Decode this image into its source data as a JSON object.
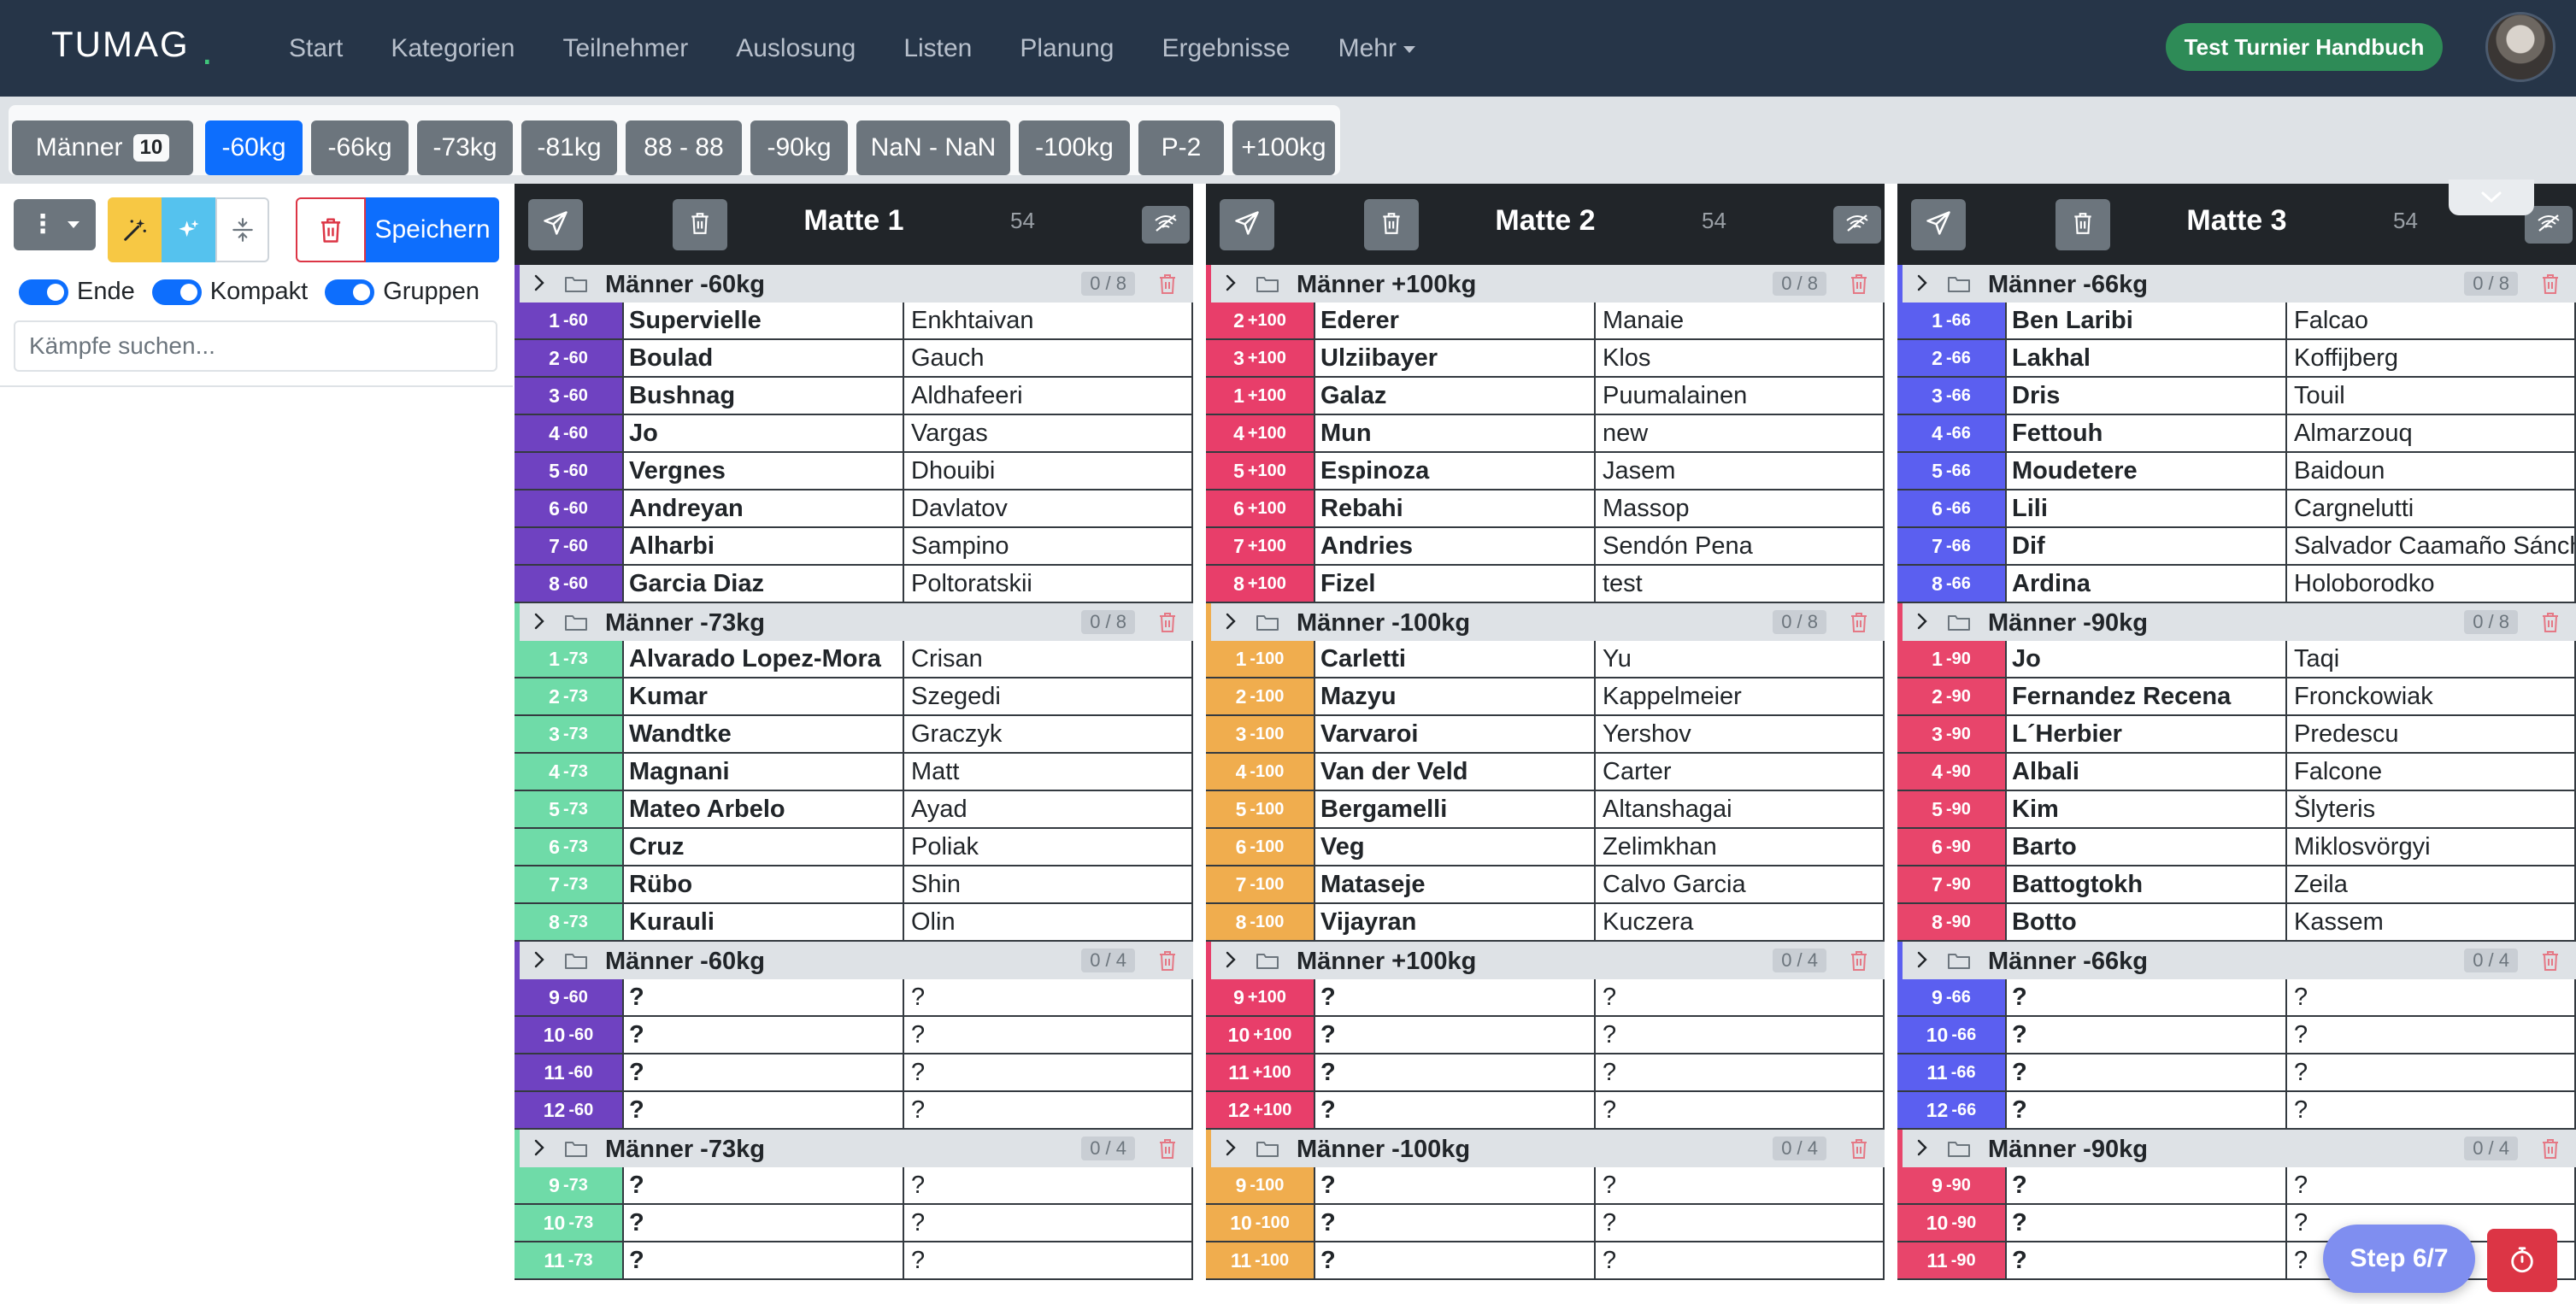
{
  "navbar": {
    "brand": "TUMAG",
    "links": [
      "Start",
      "Kategorien",
      "Teilnehmer",
      "Auslosung",
      "Listen",
      "Planung",
      "Ergebnisse",
      "Mehr"
    ],
    "tournament_button": "Test Turnier Handbuch"
  },
  "categories": {
    "group_label": "Männer",
    "group_count": "10",
    "items": [
      "-60kg",
      "-66kg",
      "-73kg",
      "-81kg",
      "88 - 88",
      "-90kg",
      "NaN - NaN",
      "-100kg",
      "P-2",
      "+100kg"
    ],
    "active": "-60kg"
  },
  "toolbar": {
    "save_label": "Speichern",
    "toggles": [
      "Ende",
      "Kompakt",
      "Gruppen"
    ],
    "search_placeholder": "Kämpfe suchen..."
  },
  "mats": [
    {
      "title": "Matte 1",
      "count": "54",
      "groups": [
        {
          "title": "Männer -60kg",
          "count": "0 / 8",
          "color": "#6f42c1",
          "weight": "-60",
          "rows": [
            [
              "1",
              "Supervielle",
              "Enkhtaivan"
            ],
            [
              "2",
              "Boulad",
              "Gauch"
            ],
            [
              "3",
              "Bushnag",
              "Aldhafeeri"
            ],
            [
              "4",
              "Jo",
              "Vargas"
            ],
            [
              "5",
              "Vergnes",
              "Dhouibi"
            ],
            [
              "6",
              "Andreyan",
              "Davlatov"
            ],
            [
              "7",
              "Alharbi",
              "Sampino"
            ],
            [
              "8",
              "Garcia Diaz",
              "Poltoratskii"
            ]
          ]
        },
        {
          "title": "Männer -73kg",
          "count": "0 / 8",
          "color": "#6fdba8",
          "weight": "-73",
          "rows": [
            [
              "1",
              "Alvarado Lopez-Mora",
              "Crisan"
            ],
            [
              "2",
              "Kumar",
              "Szegedi"
            ],
            [
              "3",
              "Wandtke",
              "Graczyk"
            ],
            [
              "4",
              "Magnani",
              "Matt"
            ],
            [
              "5",
              "Mateo Arbelo",
              "Ayad"
            ],
            [
              "6",
              "Cruz",
              "Poliak"
            ],
            [
              "7",
              "Rübo",
              "Shin"
            ],
            [
              "8",
              "Kurauli",
              "Olin"
            ]
          ]
        },
        {
          "title": "Männer -60kg",
          "count": "0 / 4",
          "color": "#6f42c1",
          "weight": "-60",
          "rows": [
            [
              "9",
              "?",
              "?"
            ],
            [
              "10",
              "?",
              "?"
            ],
            [
              "11",
              "?",
              "?"
            ],
            [
              "12",
              "?",
              "?"
            ]
          ]
        },
        {
          "title": "Männer -73kg",
          "count": "0 / 4",
          "color": "#6fdba8",
          "weight": "-73",
          "rows": [
            [
              "9",
              "?",
              "?"
            ],
            [
              "10",
              "?",
              "?"
            ],
            [
              "11",
              "?",
              "?"
            ]
          ]
        }
      ]
    },
    {
      "title": "Matte 2",
      "count": "54",
      "groups": [
        {
          "title": "Männer +100kg",
          "count": "0 / 8",
          "color": "#e83e6a",
          "weight": "+100",
          "rows": [
            [
              "2",
              "Ederer",
              "Manaie"
            ],
            [
              "3",
              "Ulziibayer",
              "Klos"
            ],
            [
              "1",
              "Galaz",
              "Puumalainen"
            ],
            [
              "4",
              "Mun",
              "new"
            ],
            [
              "5",
              "Espinoza",
              "Jasem"
            ],
            [
              "6",
              "Rebahi",
              "Massop"
            ],
            [
              "7",
              "Andries",
              "Sendón Pena"
            ],
            [
              "8",
              "Fizel",
              "test"
            ]
          ]
        },
        {
          "title": "Männer -100kg",
          "count": "0 / 8",
          "color": "#f0ad4e",
          "weight": "-100",
          "rows": [
            [
              "1",
              "Carletti",
              "Yu"
            ],
            [
              "2",
              "Mazyu",
              "Kappelmeier"
            ],
            [
              "3",
              "Varvaroi",
              "Yershov"
            ],
            [
              "4",
              "Van der Veld",
              "Carter"
            ],
            [
              "5",
              "Bergamelli",
              "Altanshagai"
            ],
            [
              "6",
              "Veg",
              "Zelimkhan"
            ],
            [
              "7",
              "Mataseje",
              "Calvo Garcia"
            ],
            [
              "8",
              "Vijayran",
              "Kuczera"
            ]
          ]
        },
        {
          "title": "Männer +100kg",
          "count": "0 / 4",
          "color": "#e83e6a",
          "weight": "+100",
          "rows": [
            [
              "9",
              "?",
              "?"
            ],
            [
              "10",
              "?",
              "?"
            ],
            [
              "11",
              "?",
              "?"
            ],
            [
              "12",
              "?",
              "?"
            ]
          ]
        },
        {
          "title": "Männer -100kg",
          "count": "0 / 4",
          "color": "#f0ad4e",
          "weight": "-100",
          "rows": [
            [
              "9",
              "?",
              "?"
            ],
            [
              "10",
              "?",
              "?"
            ],
            [
              "11",
              "?",
              "?"
            ]
          ]
        }
      ]
    },
    {
      "title": "Matte 3",
      "count": "54",
      "groups": [
        {
          "title": "Männer -66kg",
          "count": "0 / 8",
          "color": "#5b5ff0",
          "weight": "-66",
          "rows": [
            [
              "1",
              "Ben Laribi",
              "Falcao"
            ],
            [
              "2",
              "Lakhal",
              "Koffijberg"
            ],
            [
              "3",
              "Dris",
              "Touil"
            ],
            [
              "4",
              "Fettouh",
              "Almarzouq"
            ],
            [
              "5",
              "Moudetere",
              "Baidoun"
            ],
            [
              "6",
              "Lili",
              "Cargnelutti"
            ],
            [
              "7",
              "Dif",
              "Salvador Caamaño Sánchez"
            ],
            [
              "8",
              "Ardina",
              "Holoborodko"
            ]
          ]
        },
        {
          "title": "Männer -90kg",
          "count": "0 / 8",
          "color": "#e8456b",
          "weight": "-90",
          "rows": [
            [
              "1",
              "Jo",
              "Taqi"
            ],
            [
              "2",
              "Fernandez Recena",
              "Fronckowiak"
            ],
            [
              "3",
              "L´Herbier",
              "Predescu"
            ],
            [
              "4",
              "Albali",
              "Falcone"
            ],
            [
              "5",
              "Kim",
              "Šlyteris"
            ],
            [
              "6",
              "Barto",
              "Miklosvörgyi"
            ],
            [
              "7",
              "Battogtokh",
              "Zeila"
            ],
            [
              "8",
              "Botto",
              "Kassem"
            ]
          ]
        },
        {
          "title": "Männer -66kg",
          "count": "0 / 4",
          "color": "#5b5ff0",
          "weight": "-66",
          "rows": [
            [
              "9",
              "?",
              "?"
            ],
            [
              "10",
              "?",
              "?"
            ],
            [
              "11",
              "?",
              "?"
            ],
            [
              "12",
              "?",
              "?"
            ]
          ]
        },
        {
          "title": "Männer -90kg",
          "count": "0 / 4",
          "color": "#e8456b",
          "weight": "-90",
          "rows": [
            [
              "9",
              "?",
              "?"
            ],
            [
              "10",
              "?",
              "?"
            ],
            [
              "11",
              "?",
              "?"
            ]
          ]
        }
      ]
    }
  ],
  "floating": {
    "step_label": "Step 6/7"
  },
  "colors": {
    "navbar": "#263548",
    "primary": "#0d6efd",
    "success": "#2e8b57",
    "danger": "#dc3545"
  }
}
